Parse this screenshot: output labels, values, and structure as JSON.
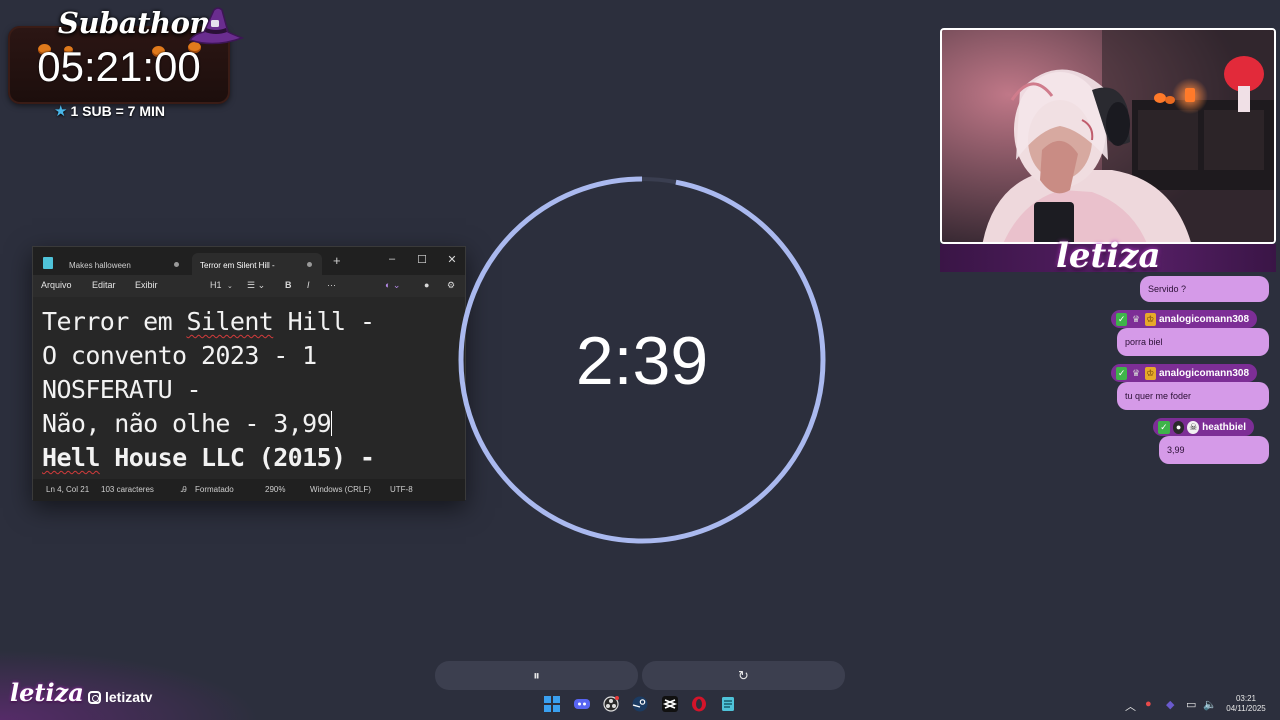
{
  "subathon": {
    "title": "Subathon",
    "timer": "05:21:00",
    "rate": "1 SUB = 7 MIN",
    "icons": [
      "witch-hat-icon",
      "star-icon",
      "pumpkin-icon"
    ]
  },
  "notepad": {
    "tabs": [
      {
        "label": "Makes halloween",
        "active": false
      },
      {
        "label": "Terror em Silent Hill -",
        "active": true
      }
    ],
    "menu": [
      "Arquivo",
      "Editar",
      "Exibir"
    ],
    "toolbar": {
      "heading": "H1",
      "more": "···"
    },
    "lines": [
      "Terror em Silent Hill -",
      "O convento 2023 - 1",
      "NOSFERATU -",
      "Não, não olhe - 3,99",
      "Hell House LLC (2015) -"
    ],
    "status": {
      "position": "Ln 4, Col 21",
      "chars": "103 caracteres",
      "format": "Formatado",
      "zoom": "290%",
      "line_ending": "Windows (CRLF)",
      "encoding": "UTF-8"
    }
  },
  "countdown": {
    "time": "2:39",
    "progress": 0.97,
    "ring_color": "#aab9ef",
    "track_color": "#3a3e50"
  },
  "brand": {
    "name": "letiza",
    "social": "letizatv"
  },
  "chat": {
    "messages": [
      {
        "user": "",
        "text": "Servido ?"
      },
      {
        "user": "analogicomann308",
        "text": "porra biel"
      },
      {
        "user": "analogicomann308",
        "text": "tu quer me foder"
      },
      {
        "user": "heathbiel",
        "text": "3,99"
      }
    ]
  },
  "controls": {
    "pause_icon": "pause-icon",
    "pause_label": "⏸",
    "reset_icon": "reset-icon",
    "reset_label": "↻"
  },
  "taskbar": {
    "apps": [
      "windows-start-icon",
      "discord-icon",
      "obs-icon",
      "steam-icon",
      "capcut-icon",
      "opera-icon",
      "notepad-icon"
    ],
    "time": "03:21",
    "date": "04/11/2025"
  },
  "colors": {
    "background": "#2c2f3d",
    "chat_bubble": "#d59ae8",
    "chat_name": "#7d2e96",
    "accent_ring": "#aab9ef"
  }
}
